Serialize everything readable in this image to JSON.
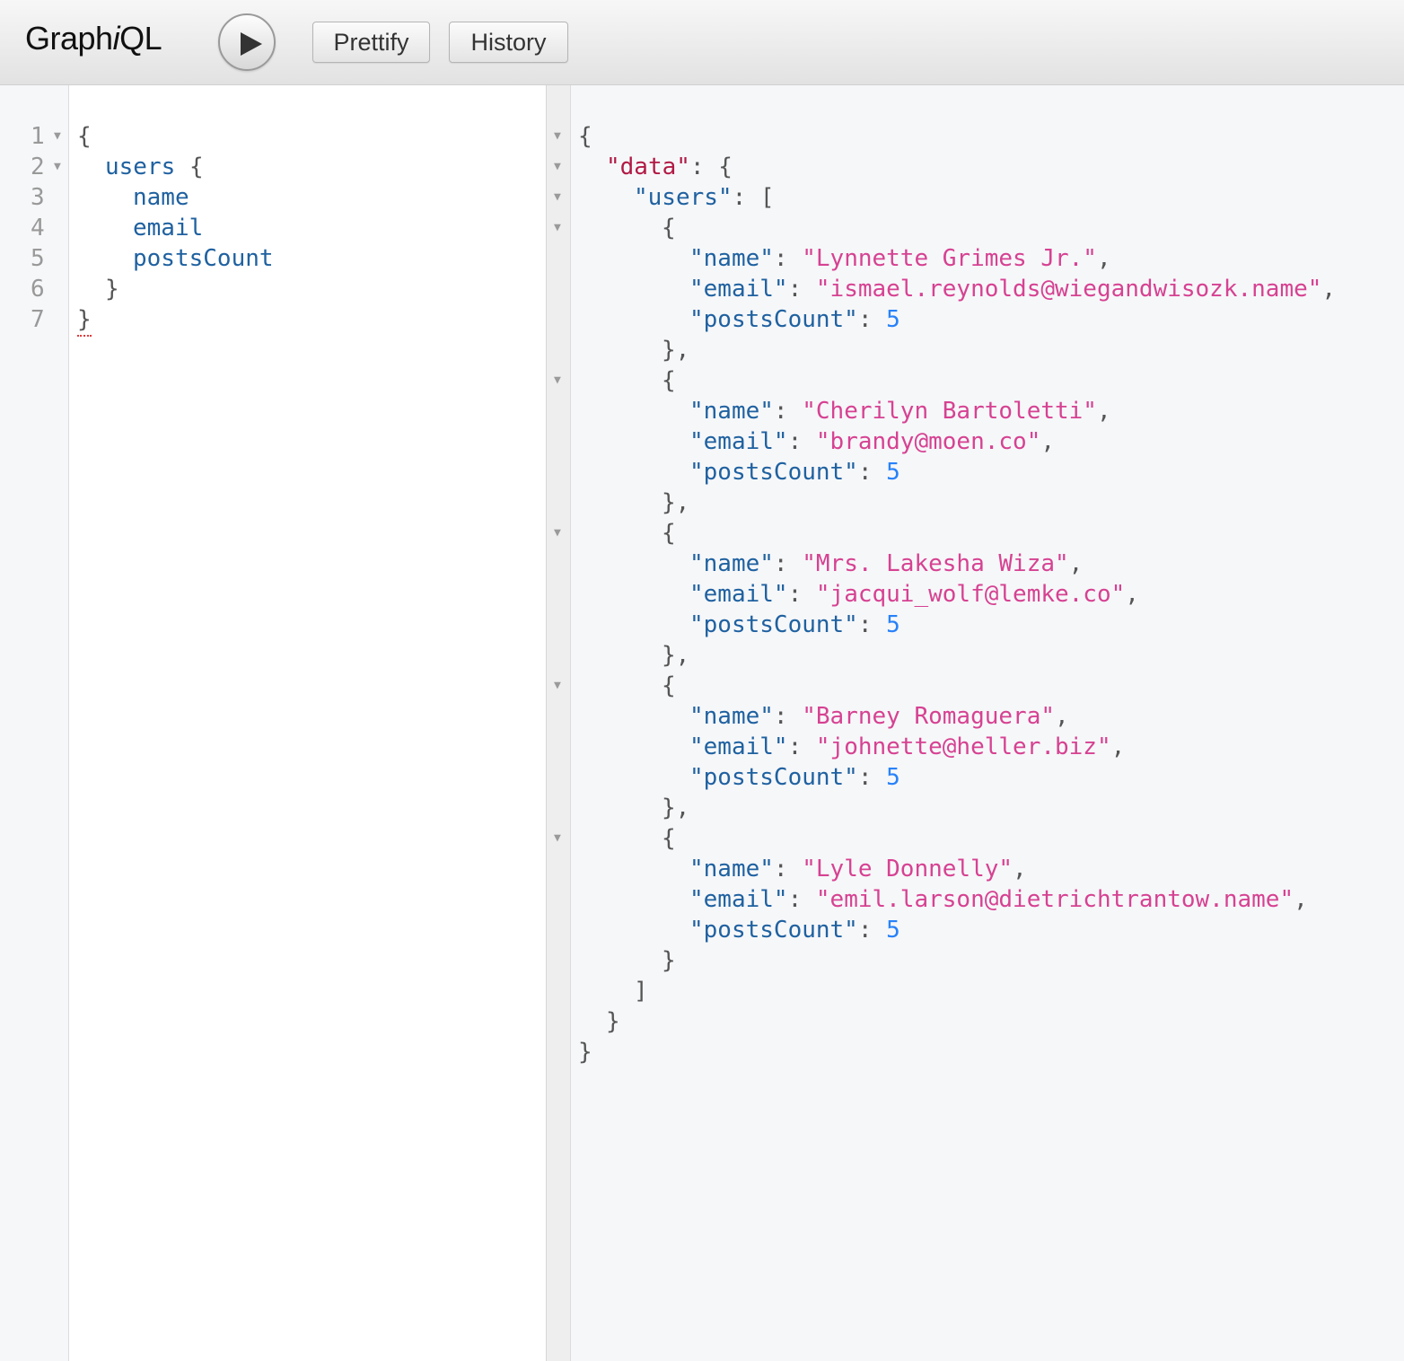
{
  "toolbar": {
    "logo_prefix": "Graph",
    "logo_italic": "i",
    "logo_suffix": "QL",
    "prettify_label": "Prettify",
    "history_label": "History"
  },
  "query": {
    "line_numbers": [
      "1",
      "2",
      "3",
      "4",
      "5",
      "6",
      "7"
    ],
    "open_brace": "{",
    "users_field": "users",
    "fields": [
      "name",
      "email",
      "postsCount"
    ],
    "close_brace": "}"
  },
  "result": {
    "data_key": "\"data\"",
    "users_key": "\"users\"",
    "name_key": "\"name\"",
    "email_key": "\"email\"",
    "posts_key": "\"postsCount\"",
    "users": [
      {
        "name": "\"Lynnette Grimes Jr.\"",
        "email": "\"ismael.reynolds@wiegandwisozk.name\"",
        "postsCount": "5"
      },
      {
        "name": "\"Cherilyn Bartoletti\"",
        "email": "\"brandy@moen.co\"",
        "postsCount": "5"
      },
      {
        "name": "\"Mrs. Lakesha Wiza\"",
        "email": "\"jacqui_wolf@lemke.co\"",
        "postsCount": "5"
      },
      {
        "name": "\"Barney Romaguera\"",
        "email": "\"johnette@heller.biz\"",
        "postsCount": "5"
      },
      {
        "name": "\"Lyle Donnelly\"",
        "email": "\"emil.larson@dietrichtrantow.name\"",
        "postsCount": "5"
      }
    ]
  },
  "colors": {
    "field": "#1f61a0",
    "string": "#d64292",
    "number": "#2882f9",
    "data_key": "#b11a45"
  },
  "icons": {
    "run": "play-icon",
    "fold": "fold-arrow-icon"
  }
}
